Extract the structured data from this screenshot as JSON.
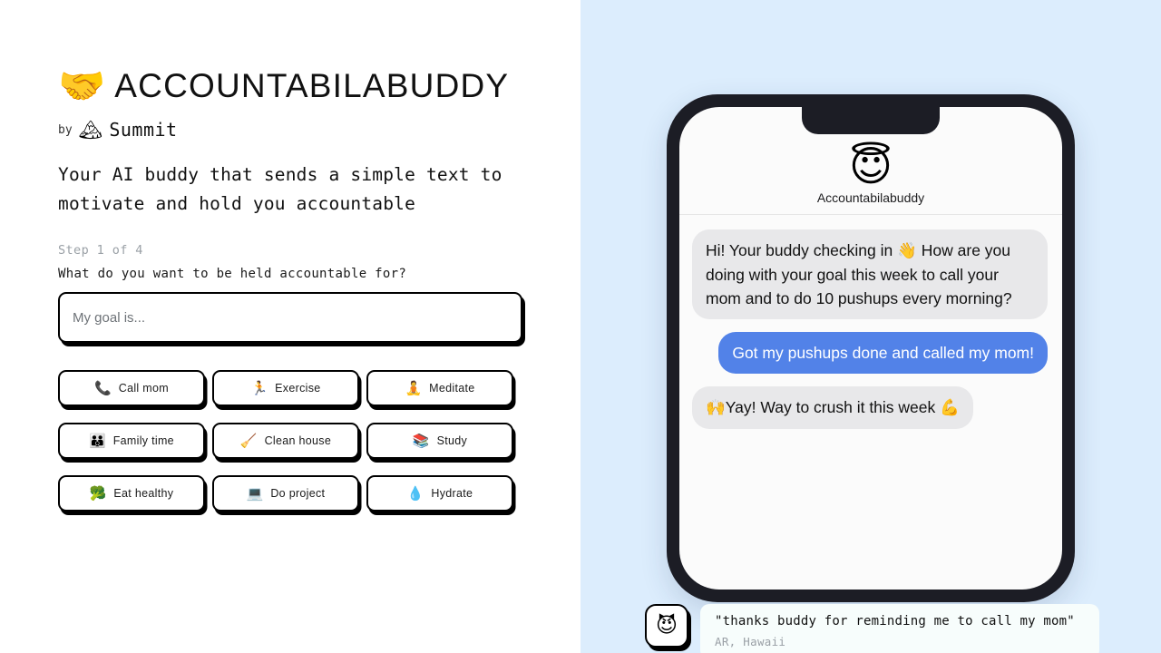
{
  "brand": {
    "logo_icon": "handshake-emoji",
    "logo_glyph": "🤝",
    "title": "ACCOUNTABILABUDDY",
    "by_label": "by",
    "by_icon": "snow-capped-mountain-emoji",
    "by_glyph": "🏔",
    "by_name": "Summit",
    "tagline": "Your AI buddy that sends a simple text to motivate and hold you accountable"
  },
  "wizard": {
    "step_label": "Step 1 of 4",
    "current_step": 1,
    "total_steps": 4,
    "question": "What do you want to be held accountable for?",
    "goal_input_value": "",
    "goal_input_placeholder": "My goal is..."
  },
  "suggestions": [
    {
      "glyph": "📞",
      "icon": "telephone-receiver-emoji",
      "label": "Call mom"
    },
    {
      "glyph": "🏃",
      "icon": "runner-emoji",
      "label": "Exercise"
    },
    {
      "glyph": "🧘",
      "icon": "person-in-lotus-position-emoji",
      "label": "Meditate"
    },
    {
      "glyph": "👪",
      "icon": "family-emoji",
      "label": "Family time"
    },
    {
      "glyph": "🧹",
      "icon": "broom-emoji",
      "label": "Clean house"
    },
    {
      "glyph": "📚",
      "icon": "books-emoji",
      "label": "Study"
    },
    {
      "glyph": "🥦",
      "icon": "broccoli-emoji",
      "label": "Eat healthy"
    },
    {
      "glyph": "💻",
      "icon": "laptop-emoji",
      "label": "Do project"
    },
    {
      "glyph": "💧",
      "icon": "droplet-emoji",
      "label": "Hydrate"
    }
  ],
  "phone": {
    "header": {
      "avatar_icon": "smiling-face-with-halo-emoji",
      "avatar_glyph": "😇",
      "name": "Accountabilabuddy"
    },
    "messages": [
      {
        "direction": "incoming",
        "text_before": "Hi! Your buddy checking in ",
        "emoji_glyph": "👋",
        "emoji_icon": "waving-hand-emoji",
        "text_after": " How are you doing with your goal this week to call your mom and to do 10 pushups every morning?"
      },
      {
        "direction": "outgoing",
        "text_before": "Got my pushups done and called my mom!",
        "emoji_glyph": "",
        "emoji_icon": "",
        "text_after": ""
      },
      {
        "direction": "incoming",
        "text_before": "",
        "emoji_glyph": "🙌",
        "emoji_icon": "raising-hands-emoji",
        "text_after": "Yay!  Way to crush it this week 💪"
      }
    ]
  },
  "testimonial": {
    "avatar_icon": "smiling-face-with-horns-emoji",
    "avatar_glyph": "😈",
    "quote": "\"thanks buddy for reminding me to call my mom\"",
    "author": "AR, Hawaii"
  },
  "colors": {
    "right_panel_bg": "#dcedfd",
    "phone_frame": "#1c1d25",
    "outgoing_bubble": "#5282e8",
    "incoming_bubble": "#e8e8ea",
    "border": "#000000",
    "muted_text": "#9aa0a6"
  }
}
